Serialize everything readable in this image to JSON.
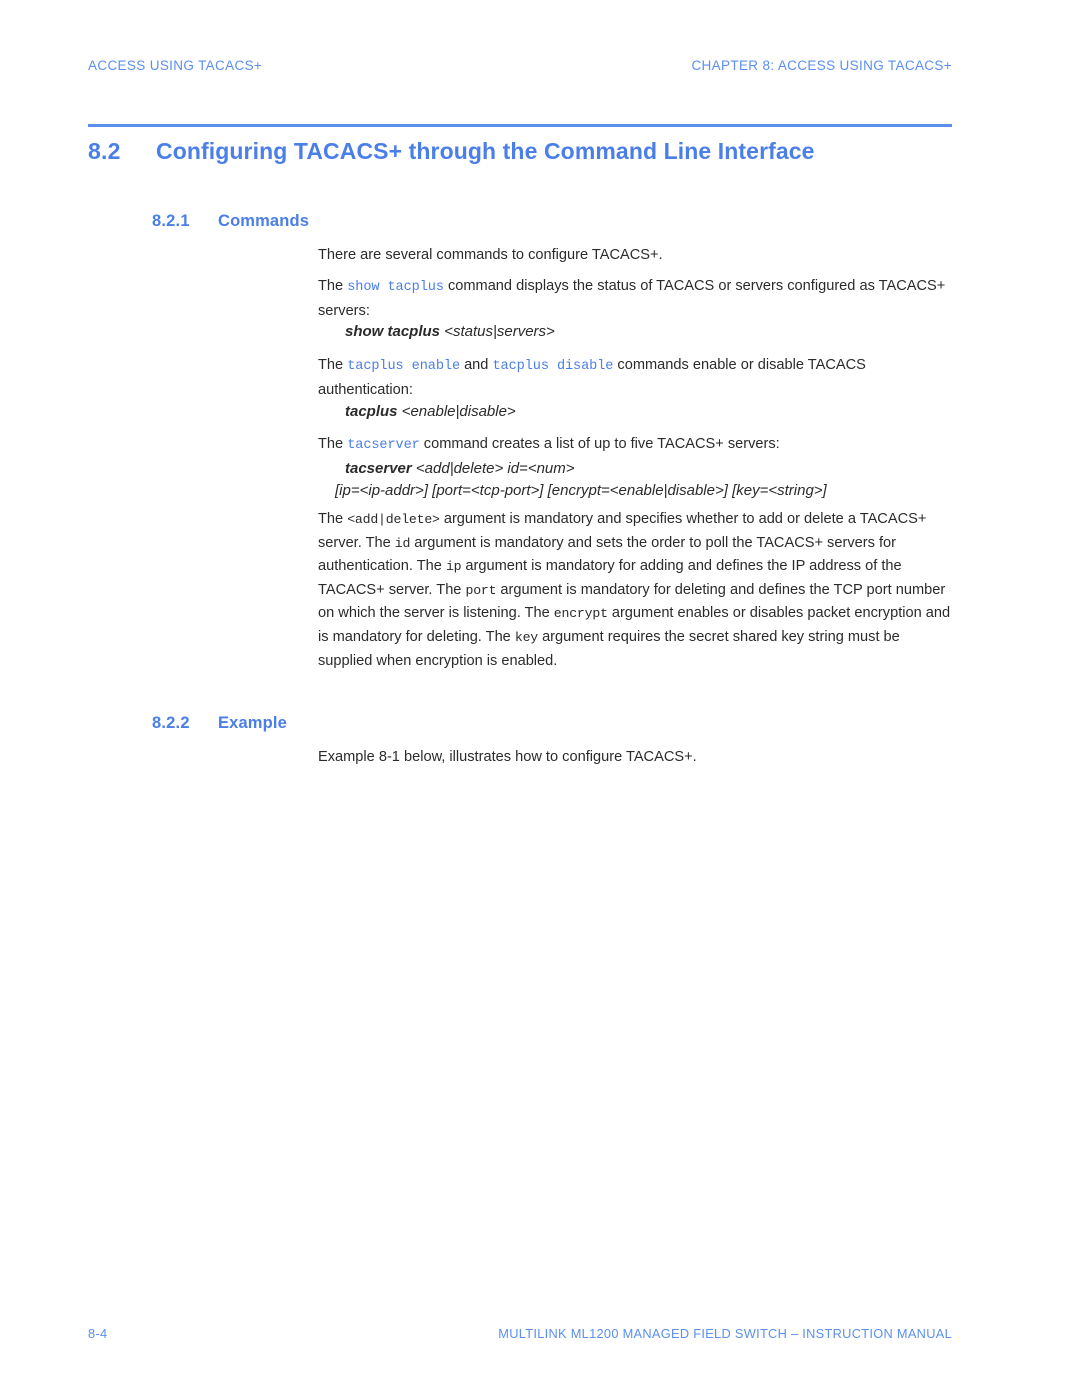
{
  "running_head": {
    "left": "ACCESS USING TACACS+",
    "right": "CHAPTER 8: ACCESS USING TACACS+"
  },
  "heading": {
    "number": "8.2",
    "title": "Configuring TACACS+ through the Command Line Interface"
  },
  "sections": {
    "commands": {
      "number": "8.2.1",
      "title": "Commands",
      "intro": "There are several commands to configure TACACS+.",
      "show_para": {
        "before": "The ",
        "code": "show tacplus",
        "after": " command displays the status of TACACS or servers configured as TACACS+ servers:"
      },
      "show_syntax": {
        "command": "show tacplus",
        "arguments": "<status|servers>"
      },
      "toggle_para": {
        "before": "The ",
        "code1": "tacplus enable",
        "middle": " and ",
        "code2": "tacplus disable",
        "after": " commands enable or disable TACACS authentication:"
      },
      "tacplus_syntax": {
        "command": "tacplus",
        "arguments": "<enable|disable>"
      },
      "tacserver_para": {
        "before": "The ",
        "code": "tacserver",
        "after": " command creates a list of up to five TACACS+ servers:"
      },
      "tacserver_syntax": {
        "command": "tacserver",
        "arguments": "<add|delete> id=<num>",
        "line2": "[ip=<ip-addr>] [port=<tcp-port>] [encrypt=<enable|disable>] [key=<string>]"
      },
      "args_para": {
        "t1": "The ",
        "c1": "<add|delete>",
        "t2": " argument is mandatory and specifies whether to add or delete a TACACS+ server. The ",
        "c2": "id",
        "t3": " argument is mandatory and sets the order to poll the TACACS+ servers for authentication. The ",
        "c3": "ip",
        "t4": " argument is mandatory for adding and defines the IP address of the TACACS+ server. The ",
        "c4": "port",
        "t5": " argument is mandatory for deleting and defines the TCP port number on which the server is listening. The ",
        "c5": "encrypt",
        "t6": " argument enables or disables packet encryption and is mandatory for deleting. The ",
        "c6": "key",
        "t7": " argument requires the secret shared key string must be supplied when encryption is enabled."
      }
    },
    "example": {
      "number": "8.2.2",
      "title": "Example",
      "text": "Example 8-1 below, illustrates how to configure TACACS+."
    }
  },
  "footer": {
    "page_number": "8-4",
    "manual": "MULTILINK ML1200 MANAGED FIELD SWITCH – INSTRUCTION MANUAL"
  },
  "colors": {
    "accent_blue": "#4a7ee8",
    "head_blue": "#5b8ff0",
    "body_text": "#2b2b2b"
  }
}
